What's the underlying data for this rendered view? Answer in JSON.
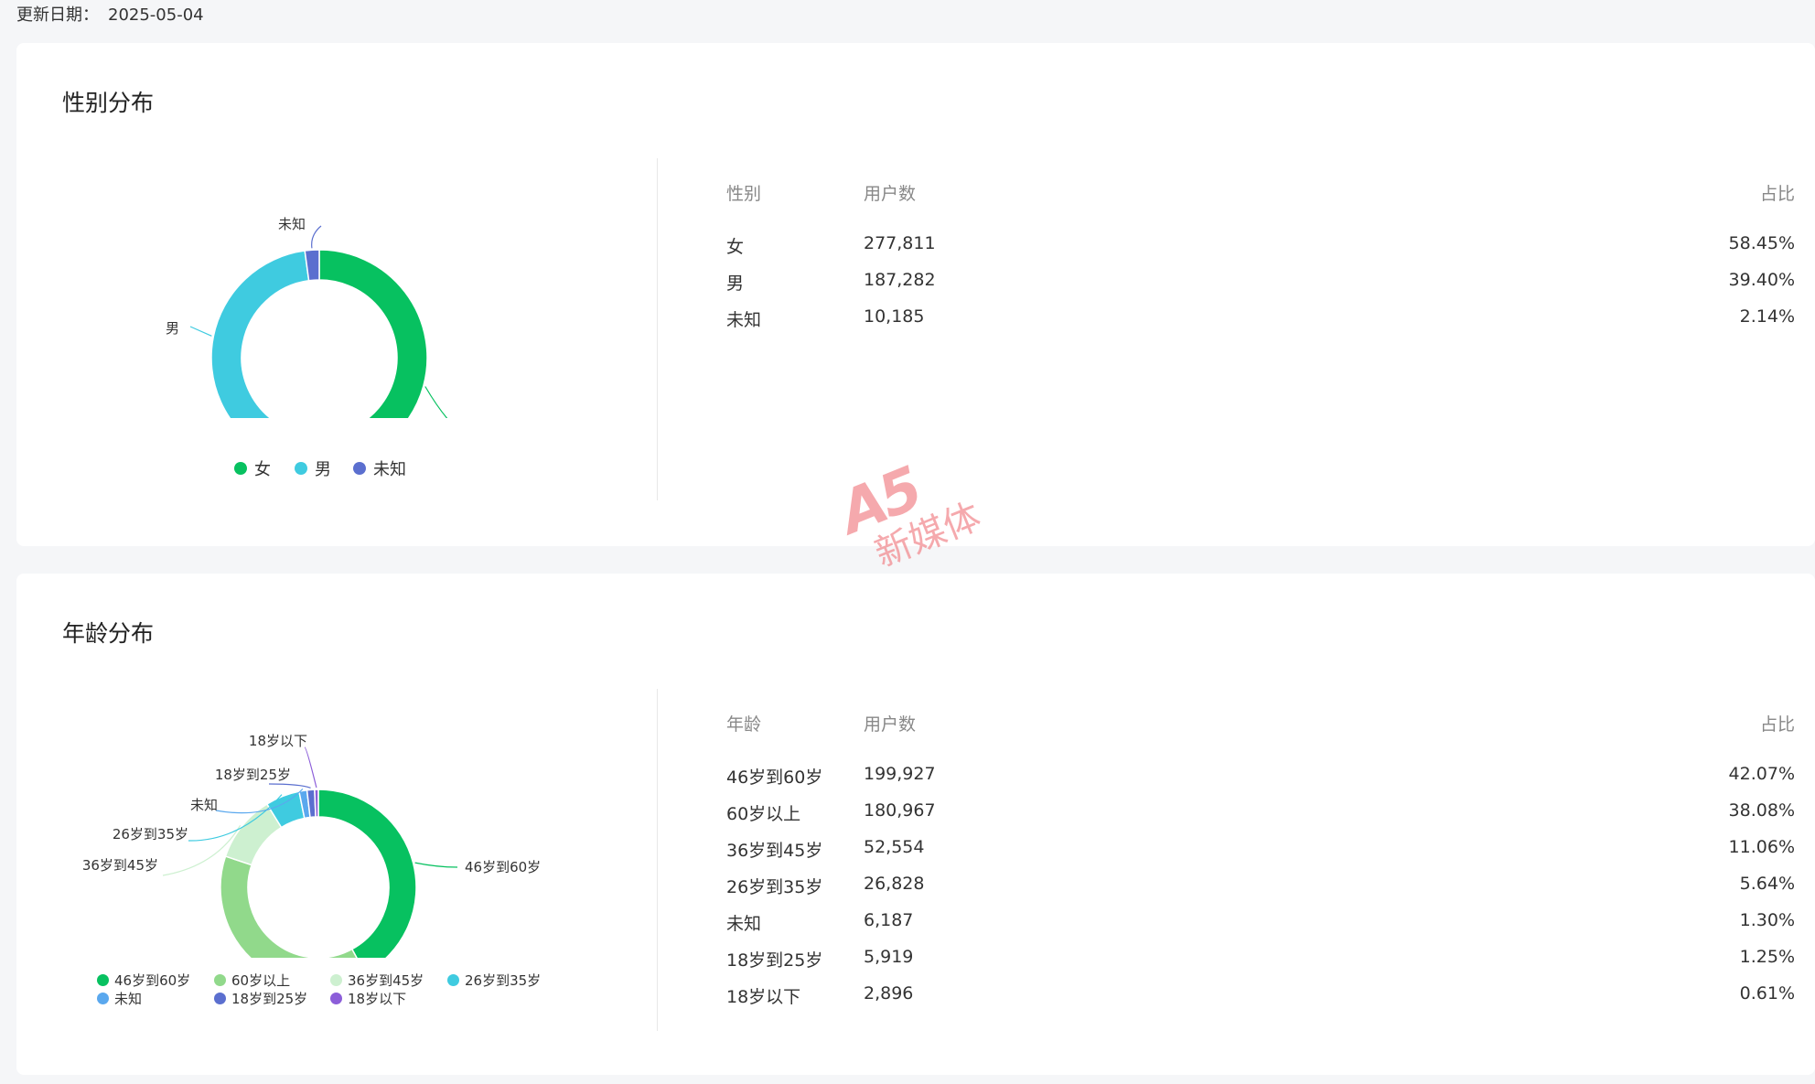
{
  "header": {
    "update_label": "更新日期：",
    "update_date": "2025-05-04"
  },
  "gender": {
    "title": "性别分布",
    "table_headers": [
      "性别",
      "用户数",
      "占比"
    ],
    "rows": [
      {
        "label": "女",
        "count": "277,811",
        "pct": "58.45%"
      },
      {
        "label": "男",
        "count": "187,282",
        "pct": "39.40%"
      },
      {
        "label": "未知",
        "count": "10,185",
        "pct": "2.14%"
      }
    ]
  },
  "age": {
    "title": "年龄分布",
    "table_headers": [
      "年龄",
      "用户数",
      "占比"
    ],
    "rows": [
      {
        "label": "46岁到60岁",
        "count": "199,927",
        "pct": "42.07%"
      },
      {
        "label": "60岁以上",
        "count": "180,967",
        "pct": "38.08%"
      },
      {
        "label": "36岁到45岁",
        "count": "52,554",
        "pct": "11.06%"
      },
      {
        "label": "26岁到35岁",
        "count": "26,828",
        "pct": "5.64%"
      },
      {
        "label": "未知",
        "count": "6,187",
        "pct": "1.30%"
      },
      {
        "label": "18岁到25岁",
        "count": "5,919",
        "pct": "1.25%"
      },
      {
        "label": "18岁以下",
        "count": "2,896",
        "pct": "0.61%"
      }
    ]
  },
  "chart_data": [
    {
      "type": "pie",
      "variant": "donut",
      "categories": [
        "女",
        "男",
        "未知"
      ],
      "values": [
        58.45,
        39.4,
        2.14
      ],
      "colors": [
        "#07c160",
        "#3fcbe0",
        "#5b6fcf"
      ],
      "legend_placement": "bottom"
    },
    {
      "type": "pie",
      "variant": "donut",
      "categories": [
        "46岁到60岁",
        "60岁以上",
        "36岁到45岁",
        "26岁到35岁",
        "未知",
        "18岁到25岁",
        "18岁以下"
      ],
      "values": [
        42.07,
        38.08,
        11.06,
        5.64,
        1.3,
        1.25,
        0.61
      ],
      "colors": [
        "#07c160",
        "#91d98b",
        "#cdf0d0",
        "#3fcbe0",
        "#5aa8ee",
        "#5b6fcf",
        "#8c5ed9"
      ],
      "legend_placement": "bottom"
    }
  ],
  "watermark": {
    "logo": "A5",
    "text": "新媒体"
  }
}
